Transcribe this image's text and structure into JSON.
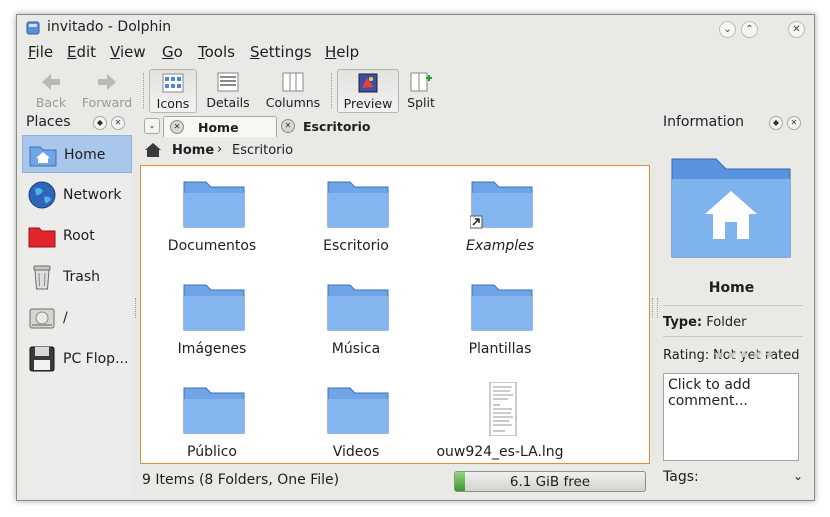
{
  "window": {
    "title": "invitado - Dolphin"
  },
  "menu": [
    {
      "prefix": "",
      "mnemonic": "F",
      "rest": "ile"
    },
    {
      "prefix": "",
      "mnemonic": "E",
      "rest": "dit"
    },
    {
      "prefix": "",
      "mnemonic": "V",
      "rest": "iew"
    },
    {
      "prefix": "",
      "mnemonic": "G",
      "rest": "o"
    },
    {
      "prefix": "",
      "mnemonic": "T",
      "rest": "ools"
    },
    {
      "prefix": "",
      "mnemonic": "S",
      "rest": "ettings"
    },
    {
      "prefix": "",
      "mnemonic": "H",
      "rest": "elp"
    }
  ],
  "toolbar": {
    "back": "Back",
    "forward": "Forward",
    "icons": "Icons",
    "details": "Details",
    "columns": "Columns",
    "preview": "Preview",
    "split": "Split"
  },
  "places": {
    "title": "Places",
    "items": [
      {
        "label": "Home",
        "icon": "home-folder-icon",
        "selected": true
      },
      {
        "label": "Network",
        "icon": "network-globe-icon",
        "selected": false
      },
      {
        "label": "Root",
        "icon": "root-folder-icon",
        "selected": false
      },
      {
        "label": "Trash",
        "icon": "trash-icon",
        "selected": false
      },
      {
        "label": "/",
        "icon": "hard-drive-icon",
        "selected": false
      },
      {
        "label": "PC Flop...",
        "icon": "floppy-icon",
        "selected": false
      }
    ]
  },
  "tabs": [
    {
      "label": "Home",
      "active": true
    },
    {
      "label": "Escritorio",
      "active": false
    }
  ],
  "breadcrumb": {
    "root": "Home",
    "current": "Escritorio"
  },
  "files": [
    {
      "name": "Documentos",
      "type": "folder"
    },
    {
      "name": "Escritorio",
      "type": "folder"
    },
    {
      "name": "Examples",
      "type": "folder-link"
    },
    {
      "name": "Imágenes",
      "type": "folder"
    },
    {
      "name": "Música",
      "type": "folder"
    },
    {
      "name": "Plantillas",
      "type": "folder"
    },
    {
      "name": "Público",
      "type": "folder"
    },
    {
      "name": "Videos",
      "type": "folder"
    },
    {
      "name": "ouw924_es-LA.lng",
      "type": "text-file"
    }
  ],
  "status": {
    "summary": "9 Items (8 Folders, One File)",
    "free": "6.1 GiB free",
    "used_fraction": 0.05
  },
  "info": {
    "title": "Information",
    "name": "Home",
    "type_label": "Type:",
    "type_value": "Folder",
    "rating_label": "Rating:",
    "rating_value": "Not yet rated",
    "comment_placeholder": "Click to add comment...",
    "tags_label": "Tags:"
  },
  "colors": {
    "selection": "#a9c7ea",
    "focus_border": "#e48b3c",
    "folder": "#6fa4e6"
  }
}
